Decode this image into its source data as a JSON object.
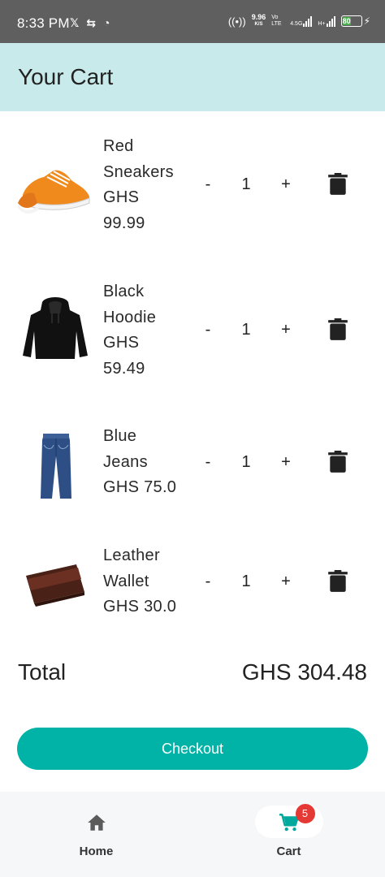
{
  "status_bar": {
    "time": "8:33 PM",
    "left_icons": [
      "x-icon",
      "sync-icon",
      "face-icon"
    ],
    "net_speed": "9.96",
    "net_unit": "K/S",
    "volte": "Vo LTE",
    "network_4g": "4.5G",
    "network_h": "H+",
    "battery": "80"
  },
  "app_bar": {
    "title": "Your Cart"
  },
  "cart": {
    "items": [
      {
        "name": "Red Sneakers",
        "price": "GHS 99.99",
        "quantity": "1",
        "minus": "-",
        "plus": "+",
        "image": "sneakers-image"
      },
      {
        "name": "Black Hoodie",
        "price": "GHS 59.49",
        "quantity": "1",
        "minus": "-",
        "plus": "+",
        "image": "hoodie-image"
      },
      {
        "name": "Blue Jeans",
        "price": "GHS 75.0",
        "quantity": "1",
        "minus": "-",
        "plus": "+",
        "image": "jeans-image"
      },
      {
        "name": "Leather Wallet",
        "price": "GHS 30.0",
        "quantity": "1",
        "minus": "-",
        "plus": "+",
        "image": "wallet-image"
      }
    ],
    "total_label": "Total",
    "total_value": "GHS 304.48",
    "checkout_label": "Checkout"
  },
  "bottom_nav": {
    "items": [
      {
        "label": "Home",
        "icon": "home-icon",
        "selected": false
      },
      {
        "label": "Cart",
        "icon": "cart-icon",
        "selected": true,
        "badge": "5"
      }
    ]
  },
  "colors": {
    "app_bar_bg": "#c8eaea",
    "accent": "#00b3a6",
    "badge": "#e53935",
    "status_bar_bg": "#5f5f5f"
  }
}
